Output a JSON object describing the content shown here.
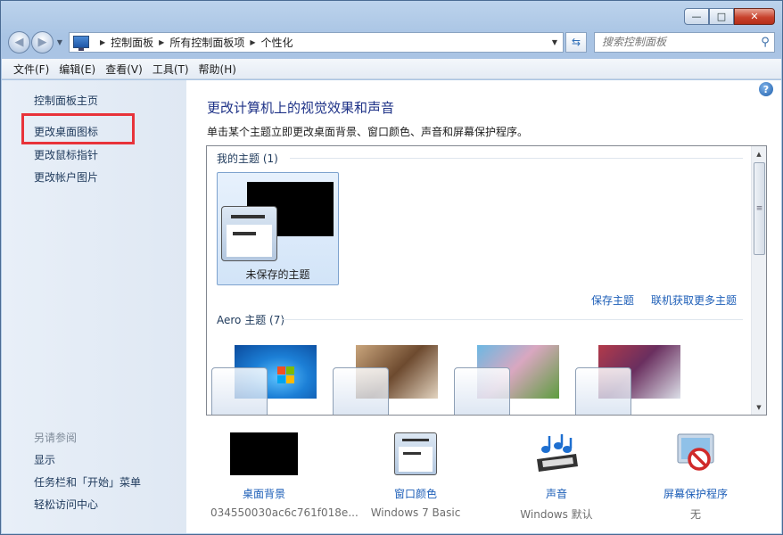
{
  "window": {
    "minimize": "—",
    "maximize": "□",
    "close": "✕"
  },
  "nav": {
    "back": "◀",
    "forward": "▶",
    "breadcrumb": [
      "控制面板",
      "所有控制面板项",
      "个性化"
    ],
    "search_placeholder": "搜索控制面板"
  },
  "menu": [
    "文件(F)",
    "编辑(E)",
    "查看(V)",
    "工具(T)",
    "帮助(H)"
  ],
  "sidebar": {
    "links": [
      "控制面板主页",
      "更改桌面图标",
      "更改鼠标指针",
      "更改帐户图片"
    ],
    "see_also_header": "另请参阅",
    "see_also": [
      "显示",
      "任务栏和「开始」菜单",
      "轻松访问中心"
    ]
  },
  "main": {
    "help": "?",
    "title": "更改计算机上的视觉效果和声音",
    "subtitle": "单击某个主题立即更改桌面背景、窗口颜色、声音和屏幕保护程序。",
    "my_themes_label": "我的主题 (1)",
    "unsaved_theme": "未保存的主题",
    "save_theme": "保存主题",
    "get_more_themes": "联机获取更多主题",
    "aero_label": "Aero 主题 (7)"
  },
  "bottom": [
    {
      "label": "桌面背景",
      "value": "034550030ac6c761f018e..."
    },
    {
      "label": "窗口颜色",
      "value": "Windows 7 Basic"
    },
    {
      "label": "声音",
      "value": "Windows 默认"
    },
    {
      "label": "屏幕保护程序",
      "value": "无"
    }
  ],
  "colors": {
    "accent_title": "#1e3287",
    "link": "#1e5fb8",
    "highlight_box": "#e8333a"
  }
}
